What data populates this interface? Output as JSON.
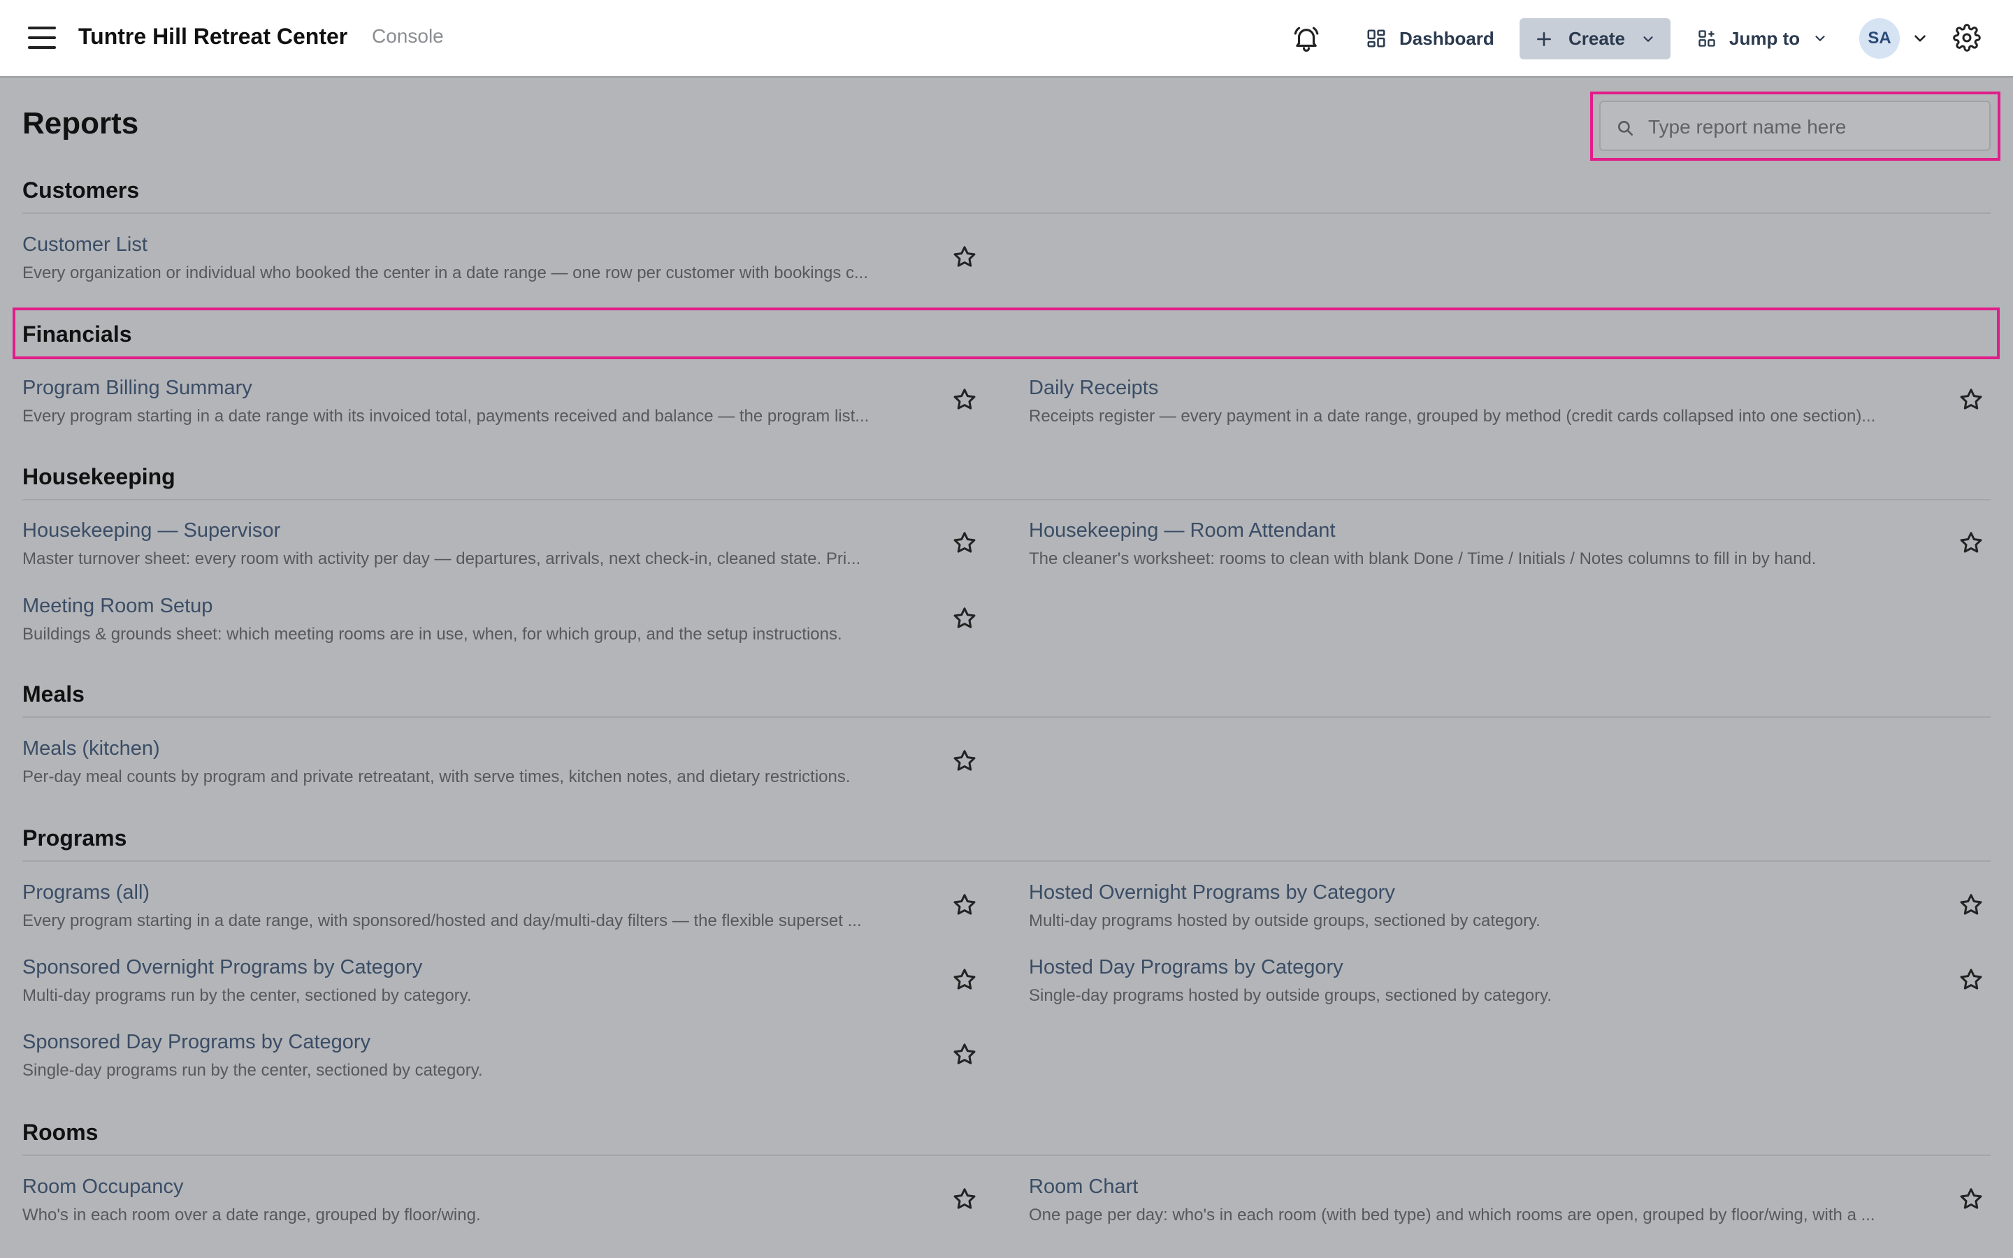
{
  "header": {
    "app_title": "Tuntre Hill Retreat Center",
    "subtitle": "Console",
    "dashboard_label": "Dashboard",
    "create_label": "Create",
    "jump_label": "Jump to",
    "avatar_initials": "SA"
  },
  "page": {
    "title": "Reports",
    "search_placeholder": "Type report name here"
  },
  "sections": [
    {
      "title": "Customers",
      "reports": [
        {
          "name": "Customer List",
          "desc": "Every organization or individual who booked the center in a date range — one row per customer with bookings c..."
        }
      ]
    },
    {
      "title": "Financials",
      "reports": [
        {
          "name": "Program Billing Summary",
          "desc": "Every program starting in a date range with its invoiced total, payments received and balance — the program list..."
        },
        {
          "name": "Daily Receipts",
          "desc": "Receipts register — every payment in a date range, grouped by method (credit cards collapsed into one section)..."
        }
      ]
    },
    {
      "title": "Housekeeping",
      "reports": [
        {
          "name": "Housekeeping — Supervisor",
          "desc": "Master turnover sheet: every room with activity per day — departures, arrivals, next check-in, cleaned state. Pri..."
        },
        {
          "name": "Housekeeping — Room Attendant",
          "desc": "The cleaner's worksheet: rooms to clean with blank Done / Time / Initials / Notes columns to fill in by hand."
        },
        {
          "name": "Meeting Room Setup",
          "desc": "Buildings & grounds sheet: which meeting rooms are in use, when, for which group, and the setup instructions."
        }
      ]
    },
    {
      "title": "Meals",
      "reports": [
        {
          "name": "Meals (kitchen)",
          "desc": "Per-day meal counts by program and private retreatant, with serve times, kitchen notes, and dietary restrictions."
        }
      ]
    },
    {
      "title": "Programs",
      "reports": [
        {
          "name": "Programs (all)",
          "desc": "Every program starting in a date range, with sponsored/hosted and day/multi-day filters — the flexible superset ..."
        },
        {
          "name": "Hosted Overnight Programs by Category",
          "desc": "Multi-day programs hosted by outside groups, sectioned by category."
        },
        {
          "name": "Sponsored Overnight Programs by Category",
          "desc": "Multi-day programs run by the center, sectioned by category."
        },
        {
          "name": "Hosted Day Programs by Category",
          "desc": "Single-day programs hosted by outside groups, sectioned by category."
        },
        {
          "name": "Sponsored Day Programs by Category",
          "desc": "Single-day programs run by the center, sectioned by category."
        }
      ]
    },
    {
      "title": "Rooms",
      "reports": [
        {
          "name": "Room Occupancy",
          "desc": "Who's in each room over a date range, grouped by floor/wing."
        },
        {
          "name": "Room Chart",
          "desc": "One page per day: who's in each room (with bed type) and which rooms are open, grouped by floor/wing, with a ..."
        }
      ]
    }
  ],
  "colors": {
    "highlight": "#e11d8a",
    "link": "#3b4d66",
    "overlay_bg": "#b3b5b8"
  },
  "icons": [
    "menu-icon",
    "bell-icon",
    "dashboard-icon",
    "plus-icon",
    "chevron-down-icon",
    "jump-icon",
    "gear-icon",
    "search-icon",
    "star-icon"
  ]
}
